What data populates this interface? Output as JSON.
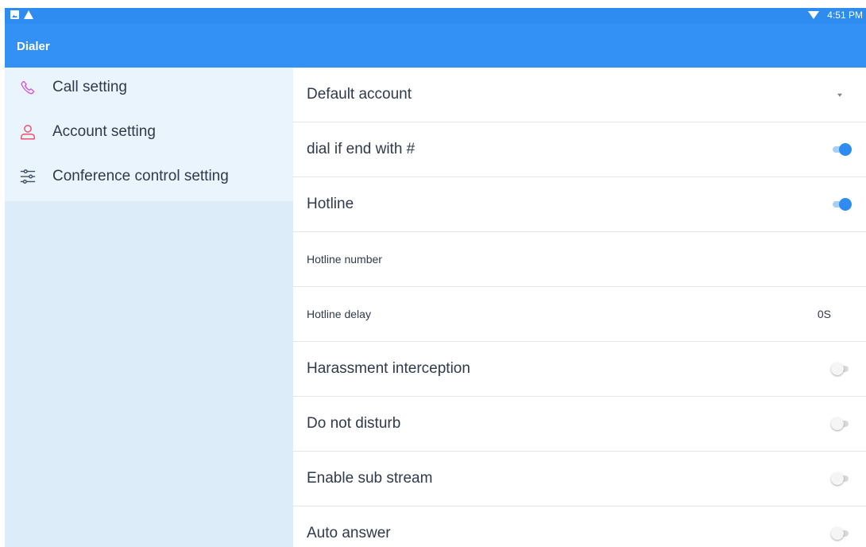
{
  "status_bar": {
    "icons": [
      "image-icon",
      "warning-icon"
    ],
    "wifi_icon": "wifi-icon",
    "time": "4:51 PM"
  },
  "app_bar": {
    "title": "Dialer"
  },
  "sidebar": {
    "items": [
      {
        "label": "Call setting",
        "icon": "phone-icon",
        "color": "#d94fd9"
      },
      {
        "label": "Account setting",
        "icon": "person-icon",
        "color": "#f0506e"
      },
      {
        "label": "Conference control setting",
        "icon": "sliders-icon",
        "color": "#3d4d66"
      }
    ]
  },
  "settings": {
    "default_account": {
      "label": "Default account"
    },
    "dial_if_end_with_hash": {
      "label": "dial if end with #",
      "enabled": true
    },
    "hotline": {
      "label": "Hotline",
      "enabled": true
    },
    "hotline_number": {
      "label": "Hotline number"
    },
    "hotline_delay": {
      "label": "Hotline delay",
      "value": "0S"
    },
    "harassment_interception": {
      "label": "Harassment interception",
      "enabled": false
    },
    "do_not_disturb": {
      "label": "Do not disturb",
      "enabled": false
    },
    "enable_sub_stream": {
      "label": "Enable sub stream",
      "enabled": false
    },
    "auto_answer": {
      "label": "Auto answer",
      "enabled": false
    }
  },
  "colors": {
    "status_bar": "#2e8cf0",
    "app_bar": "#3391f5",
    "accent": "#2e8cf0",
    "sidebar_bg": "#dcecf9"
  }
}
